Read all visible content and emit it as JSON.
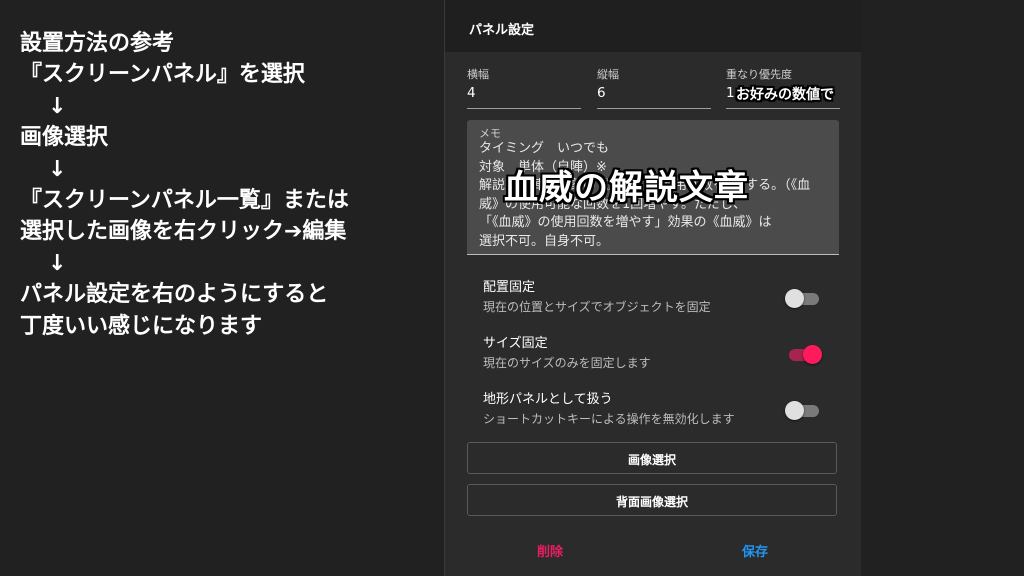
{
  "instructions": {
    "lines": [
      "設置方法の参考",
      "『スクリーンパネル』を選択",
      "↓",
      "画像選択",
      "↓",
      "『スクリーンパネル一覧』または",
      "選択した画像を右クリック➔編集",
      "↓",
      "パネル設定を右のようにすると",
      "丁度いい感じになります"
    ]
  },
  "panel": {
    "title": "パネル設定",
    "fields": {
      "width": {
        "label": "横幅",
        "value": "4"
      },
      "height": {
        "label": "縦幅",
        "value": "6"
      },
      "priority": {
        "label": "重なり優先度",
        "value": "1"
      }
    },
    "memo": {
      "label": "メモ",
      "text": "タイミング　いつでも\n対象　単体（自陣）※\n解説　自陣の対象の《血威》の使用回数を+1する。（《血\n威》の使用可能な回数を1回増やす。ただし、\n「《血威》の使用回数を増やす」効果の《血威》は\n選択不可。自身不可。"
    },
    "toggles": [
      {
        "title": "配置固定",
        "description": "現在の位置とサイズでオブジェクトを固定",
        "on": false
      },
      {
        "title": "サイズ固定",
        "description": "現在のサイズのみを固定します",
        "on": true
      },
      {
        "title": "地形パネルとして扱う",
        "description": "ショートカットキーによる操作を無効化します",
        "on": false
      }
    ],
    "buttons": {
      "image": "画像選択",
      "back_image": "背面画像選択",
      "delete": "削除",
      "save": "保存"
    },
    "colors": {
      "delete": "#e91e63",
      "save": "#2196f3",
      "toggle_on": "#ff1a5e"
    }
  },
  "callouts": {
    "priority_note": "お好みの数値で",
    "memo_note": "血威の解説文章"
  }
}
